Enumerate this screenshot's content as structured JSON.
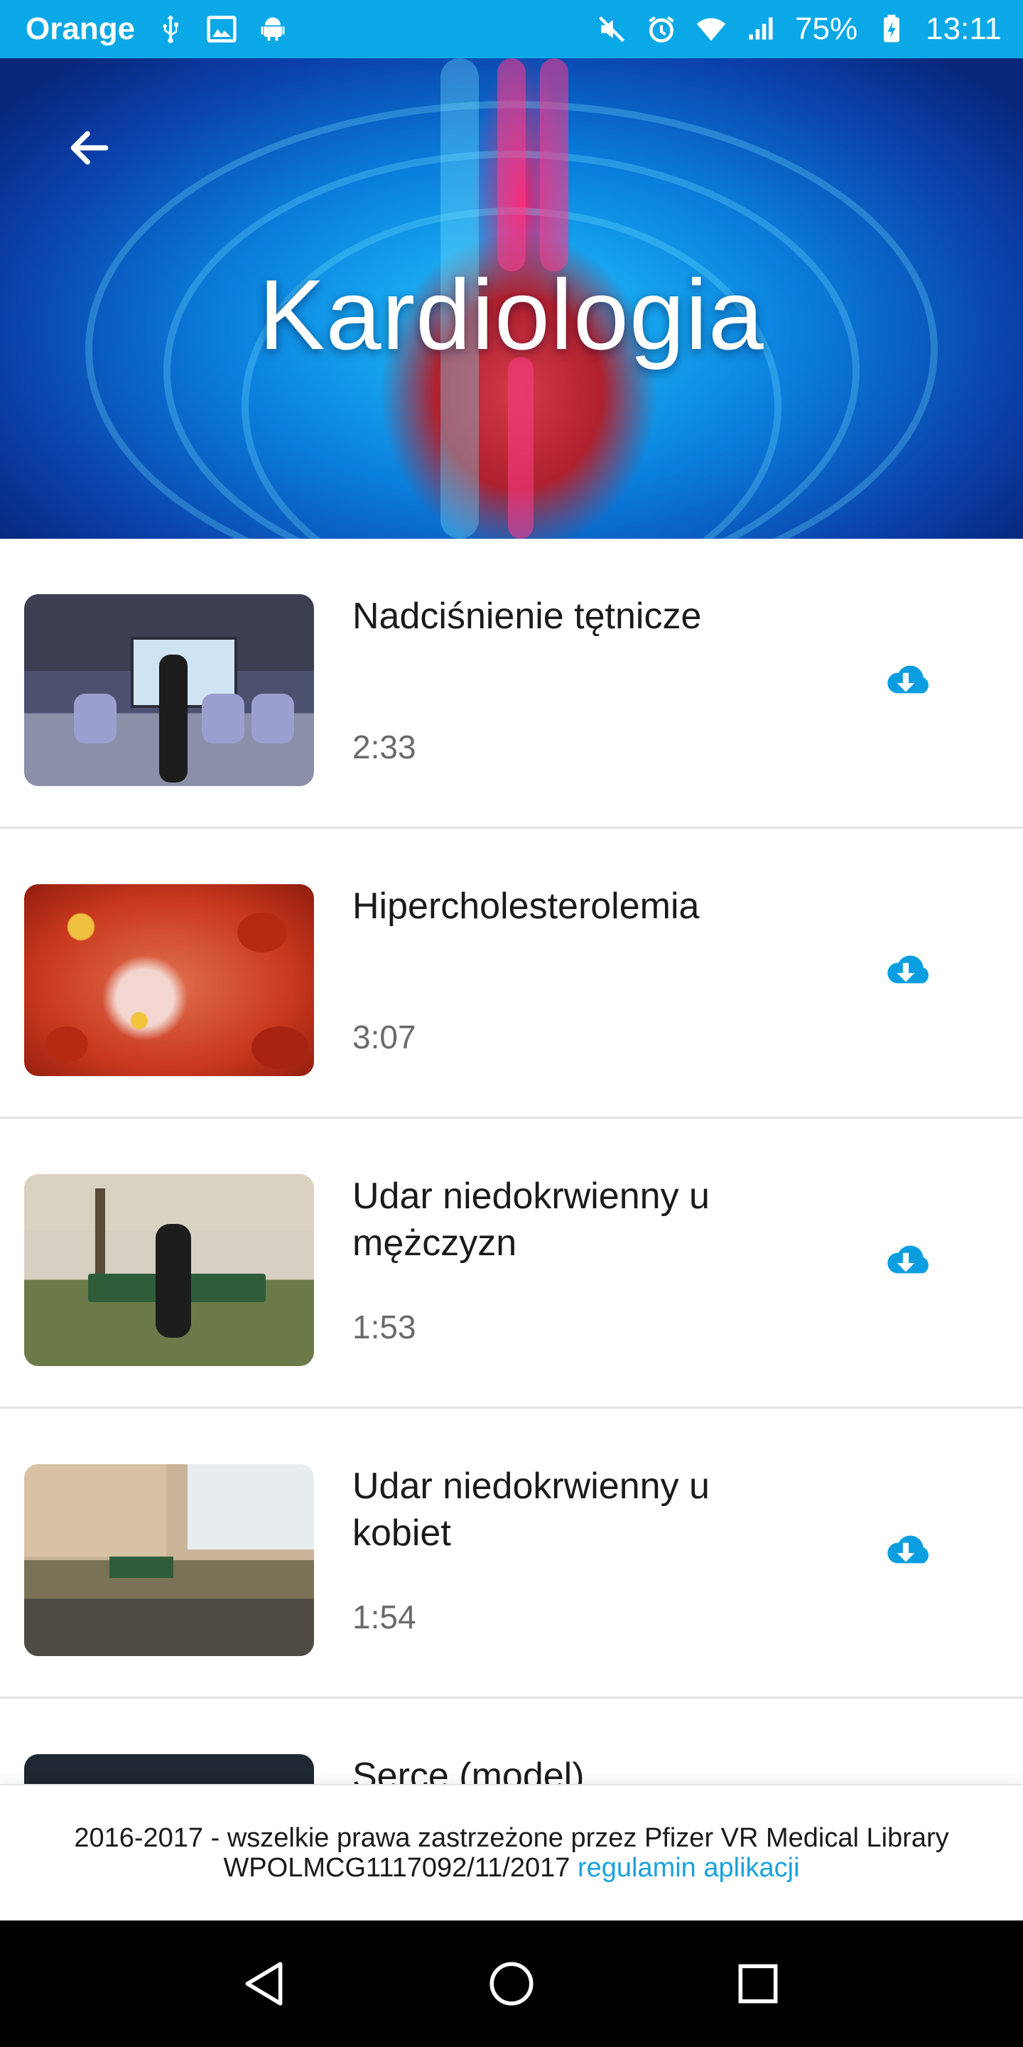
{
  "status_bar": {
    "carrier": "Orange",
    "left_icons": [
      "usb-icon",
      "image-icon",
      "android-icon"
    ],
    "right_icons": [
      "mute-icon",
      "alarm-icon",
      "wifi-icon",
      "signal-icon",
      "battery-charging-icon"
    ],
    "battery": "75%",
    "time": "13:11"
  },
  "hero": {
    "title": "Kardiologia",
    "back_icon": "arrow-back-icon"
  },
  "videos": [
    {
      "title": "Nadciśnienie tętnicze",
      "duration": "2:33",
      "action_icon": "cloud-download-icon"
    },
    {
      "title": "Hipercholesterolemia",
      "duration": "3:07",
      "action_icon": "cloud-download-icon"
    },
    {
      "title": "Udar niedokrwienny u mężczyzn",
      "duration": "1:53",
      "action_icon": "cloud-download-icon"
    },
    {
      "title": "Udar niedokrwienny u kobiet",
      "duration": "1:54",
      "action_icon": "cloud-download-icon"
    },
    {
      "title": "Serce (model)",
      "duration": "",
      "action_icon": "cloud-download-icon"
    }
  ],
  "footer": {
    "line1": "2016-2017 - wszelkie prawa zastrzeżone przez Pfizer VR Medical Library",
    "line2": "WPOLMCG1117092/11/2017",
    "link": "regulamin aplikacji",
    "link_color": "#1aa2dc"
  },
  "nav_bar": {
    "buttons": [
      "nav-back-icon",
      "nav-home-icon",
      "nav-recents-icon"
    ]
  },
  "colors": {
    "accent": "#0aa8e6",
    "download": "#0a9ee0"
  }
}
